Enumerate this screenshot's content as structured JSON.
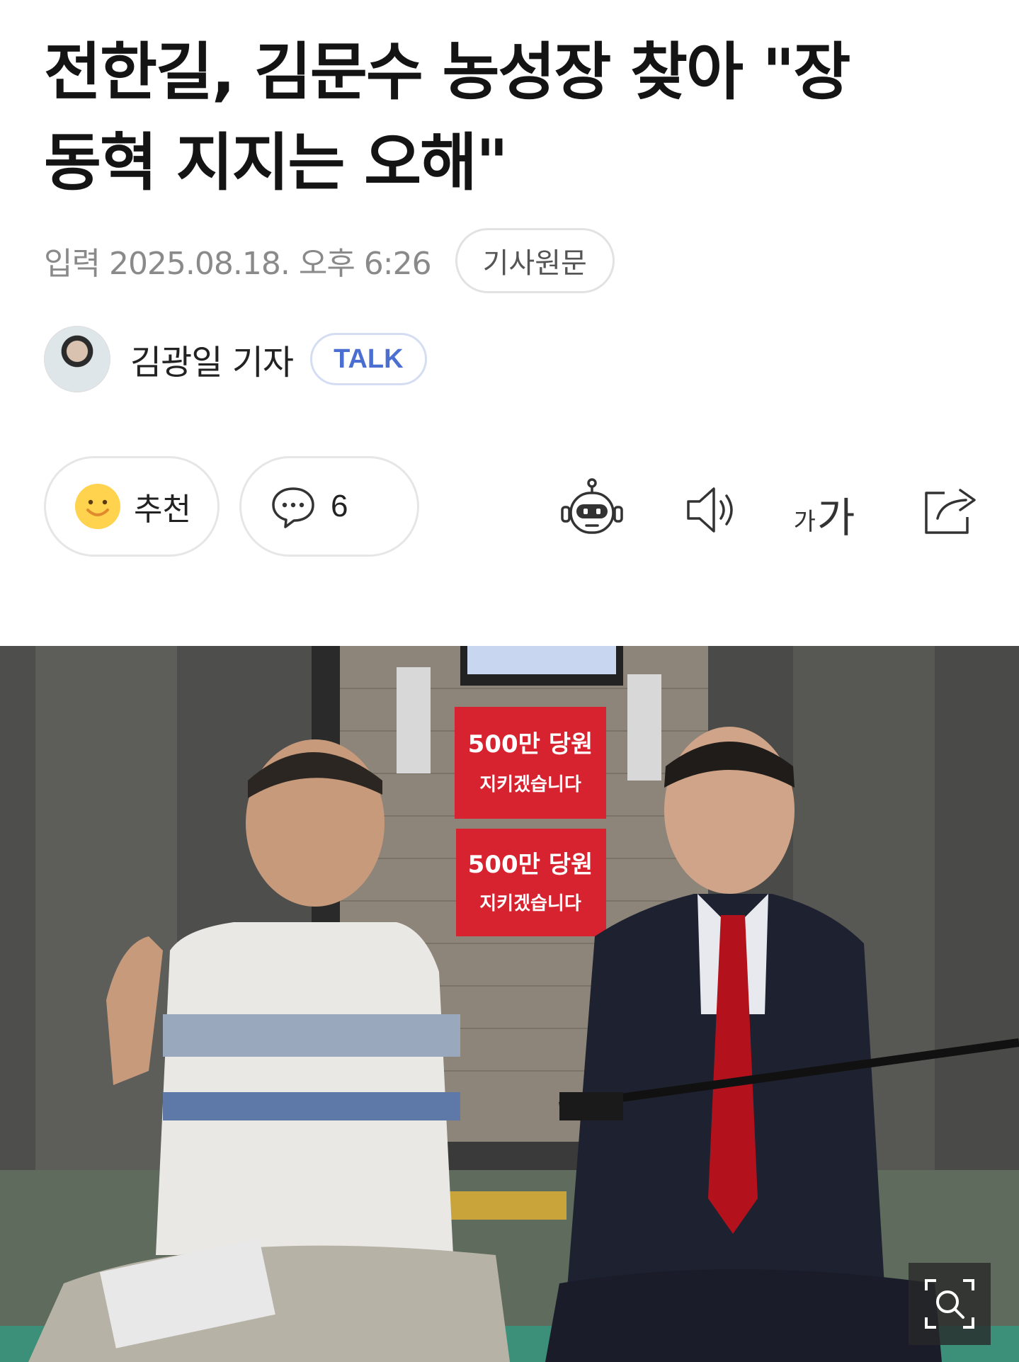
{
  "article": {
    "headline_line1": "전한길, 김문수 농성장 찾아 \"장",
    "headline_line2": "동혁 지지는 오해\"",
    "date_text": "입력 2025.08.18. 오후 6:26",
    "original_button": "기사원문"
  },
  "author": {
    "name": "김광일 기자",
    "talk_label": "TALK"
  },
  "actions": {
    "recommend_label": "추천",
    "comment_count": "6"
  },
  "photo": {
    "sign_line1": "500만 당원",
    "sign_line2": "지키겠습니다",
    "sign_color": "#d7222f"
  },
  "icons": {
    "recommend": "smile-face-icon",
    "comment": "speech-bubble-icon",
    "summary_bot": "robot-icon",
    "tts": "speaker-icon",
    "font_size": "font-size-icon",
    "share": "share-icon",
    "zoom": "zoom-icon"
  }
}
